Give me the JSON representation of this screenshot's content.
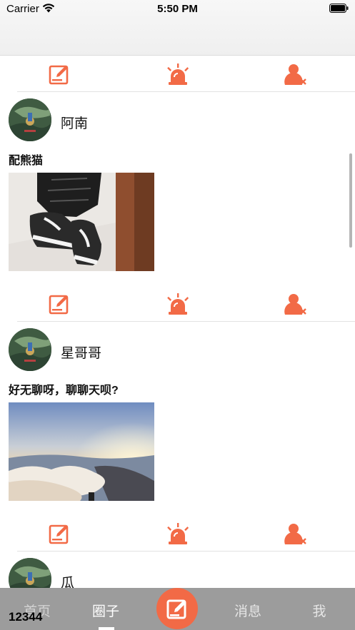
{
  "status_bar": {
    "carrier": "Carrier",
    "time": "5:50 PM"
  },
  "action_icons": [
    "edit-icon",
    "alarm-icon",
    "unfollow-user-icon"
  ],
  "accent_color": "#f26a46",
  "posts": [
    {
      "username": "阿南",
      "text": "配熊猫",
      "image": "sneakers-photo"
    },
    {
      "username": "星哥哥",
      "text": "好无聊呀，聊聊天呗?",
      "image": "sunset-clouds-photo"
    },
    {
      "username": "瓜"
    }
  ],
  "tab_bar": {
    "tabs": [
      {
        "label": "首页"
      },
      {
        "label": "圈子"
      },
      {
        "label": "消息"
      },
      {
        "label": "我"
      }
    ],
    "active_tab": "圈子",
    "center_button_icon": "compose-icon"
  },
  "overlay_counter": "12344"
}
